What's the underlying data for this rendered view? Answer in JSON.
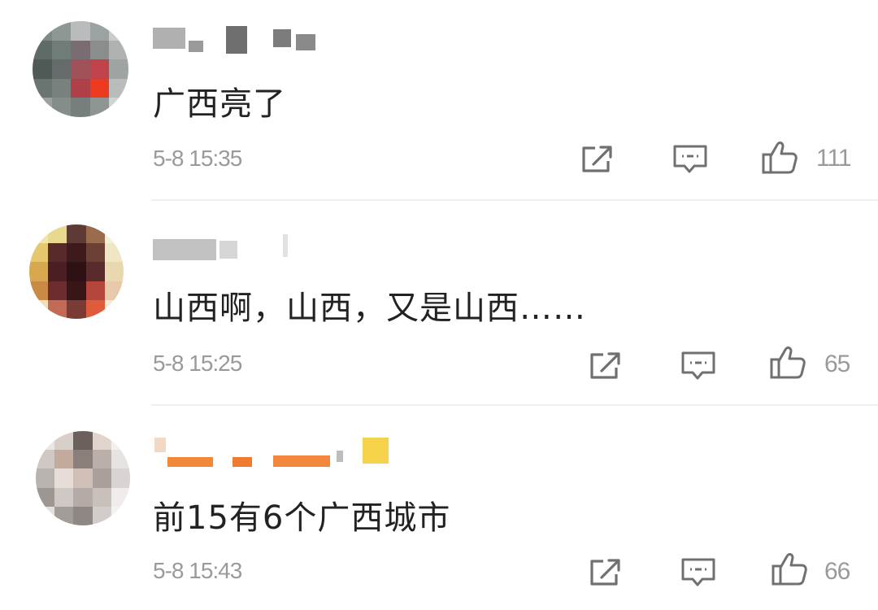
{
  "comments": [
    {
      "text": "广西亮了",
      "timestamp": "5-8 15:35",
      "likes": "111"
    },
    {
      "text": "山西啊，山西，又是山西……",
      "timestamp": "5-8 15:25",
      "likes": "65"
    },
    {
      "text": "前15有6个广西城市",
      "timestamp": "5-8 15:43",
      "likes": "66"
    }
  ],
  "icons": {
    "share": "share-icon",
    "reply": "reply-icon",
    "like": "thumbs-up-icon"
  }
}
